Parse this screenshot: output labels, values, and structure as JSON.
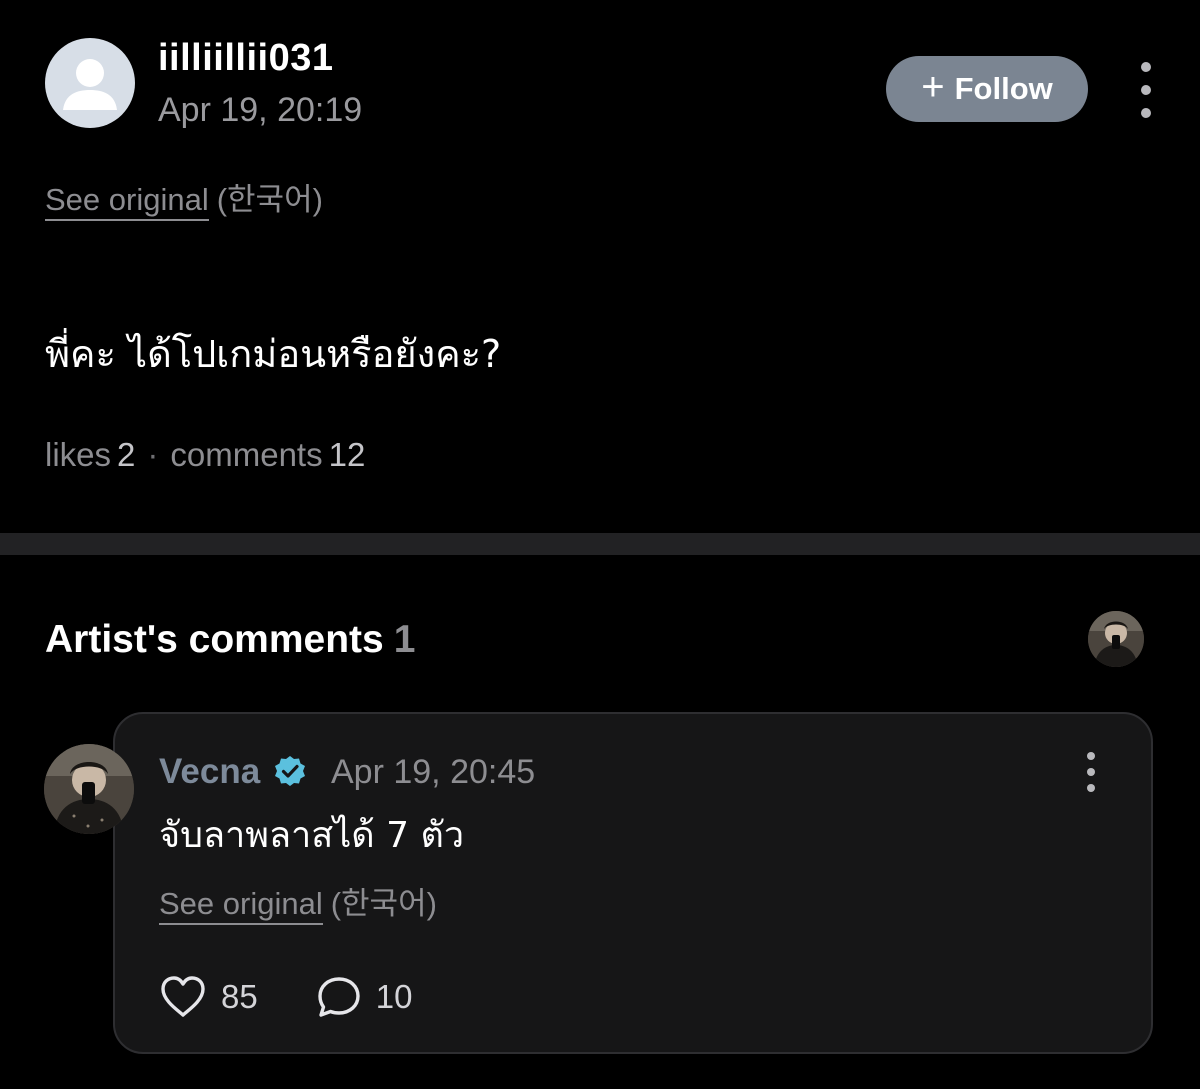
{
  "post": {
    "username": "iilliillii031",
    "date": "Apr 19, 20:19",
    "follow_label": "Follow",
    "follow_plus": "+",
    "see_original": "See original",
    "language": "(한국어)",
    "body": "พี่คะ ได้โปเกม่อนหรือยังคะ?",
    "likes_label": "likes",
    "likes_count": "2",
    "separator": "·",
    "comments_label": "comments",
    "comments_count": "12"
  },
  "artist_comments": {
    "title": "Artist's comments",
    "count": "1",
    "comments": [
      {
        "author": "Vecna",
        "verified": true,
        "date": "Apr 19, 20:45",
        "text": "จับลาพลาสได้ 7 ตัว",
        "see_original": "See original",
        "language": "(한국어)",
        "like_count": "85",
        "reply_count": "10"
      }
    ]
  },
  "colors": {
    "background": "#000000",
    "follow_button": "#7b8592",
    "verified_badge": "#5bc0de",
    "card_background": "#161617",
    "muted_text": "#8d8d91"
  },
  "icons": [
    "default-avatar-icon",
    "plus-icon",
    "more-vertical-icon",
    "verified-badge-icon",
    "heart-icon",
    "comment-bubble-icon"
  ]
}
